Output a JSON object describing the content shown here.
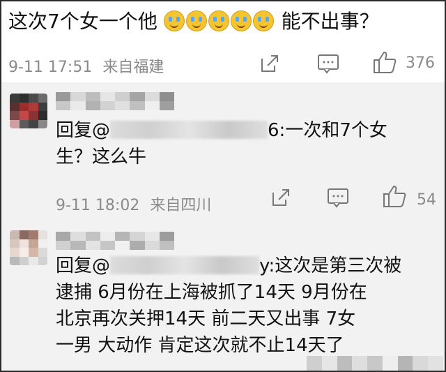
{
  "main_comment": {
    "text_before": "这次7个女一个他",
    "emoji_names": [
      "crying-laughing-emoji",
      "crying-laughing-emoji",
      "crying-laughing-emoji",
      "crying-laughing-emoji",
      "crying-laughing-emoji"
    ],
    "text_after": "能不出事？",
    "time": "9-11 17:51",
    "location": "来自福建",
    "like_count": "376"
  },
  "replies": [
    {
      "prefix": "回复@",
      "text_after_mention": "6:一次和7个女",
      "text_line2": "生？这么牛",
      "time": "9-11 18:02",
      "location": "来自四川",
      "like_count": "54"
    },
    {
      "prefix": "回复@",
      "text_after_mention": "y:这次是第三次被",
      "lines": [
        "逮捕 6月份在上海被抓了14天 9月份在",
        "北京再次关押14天 前二天又出事 7女",
        "一男 大动作 肯定这次就不止14天了"
      ]
    }
  ],
  "icons": {
    "share": "share-icon",
    "comment": "comment-icon",
    "like": "thumbs-up-icon"
  },
  "colors": {
    "reply_bg": "#f2f2f2",
    "meta": "#8a8a8a",
    "text": "#111111"
  }
}
